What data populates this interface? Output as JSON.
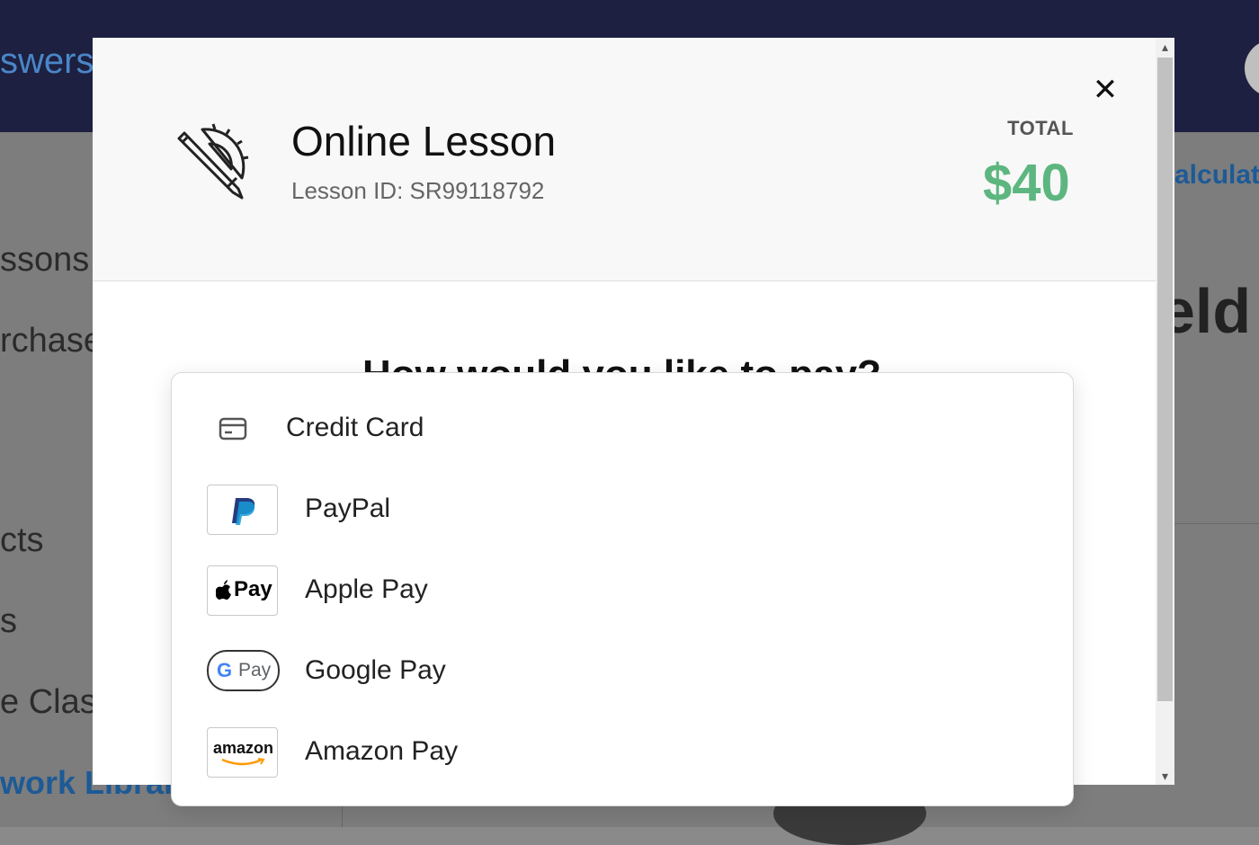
{
  "background": {
    "brand_fragment": "swers",
    "nav_items": [
      "ssons",
      "rchase",
      "cts",
      "s",
      "e Class",
      "work Library"
    ],
    "right_link": "alculate",
    "right_heading": "eld a"
  },
  "modal": {
    "title": "Online Lesson",
    "lesson_id": "Lesson ID: SR99118792",
    "total_label": "TOTAL",
    "total_amount": "$40",
    "question": "How would you like to pay?",
    "close_symbol": "✕",
    "accent_color": "#5db67f"
  },
  "payment_options": [
    {
      "label": "Credit Card",
      "icon": "credit-card-icon"
    },
    {
      "label": "PayPal",
      "icon": "paypal-logo"
    },
    {
      "label": "Apple Pay",
      "icon": "apple-pay-logo",
      "logo_text": "Pay"
    },
    {
      "label": "Google Pay",
      "icon": "google-pay-logo",
      "logo_g": "G",
      "logo_text": "Pay"
    },
    {
      "label": "Amazon Pay",
      "icon": "amazon-logo",
      "logo_text": "amazon"
    }
  ],
  "scrollbar": {
    "up": "▴",
    "down": "▾"
  }
}
